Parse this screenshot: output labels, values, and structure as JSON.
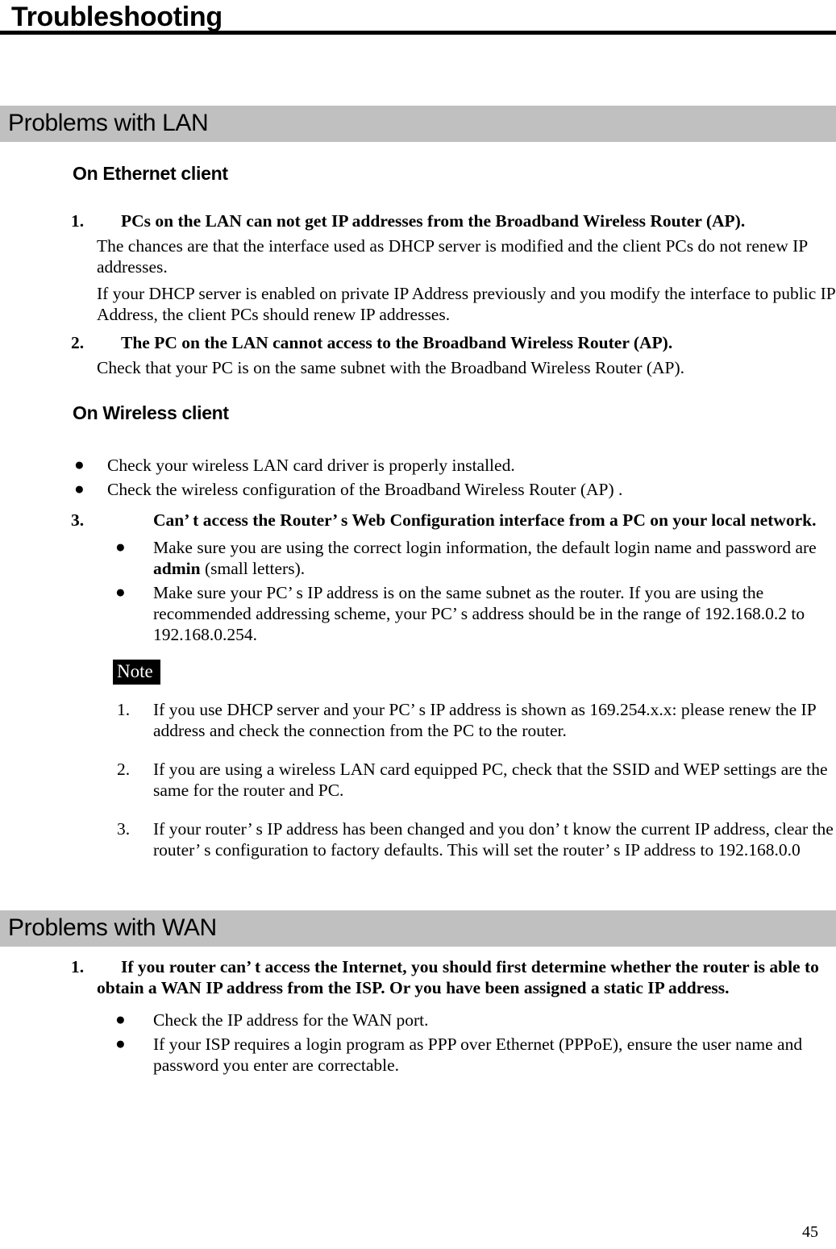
{
  "document": {
    "chapter_title": "Troubleshooting",
    "page_number": "45"
  },
  "sections": {
    "lan": {
      "bar_label": "Problems with LAN",
      "ethernet": {
        "heading": "On Ethernet client",
        "item1": {
          "marker": "1.",
          "title": "PCs on the LAN can not get IP addresses from the Broadband Wireless Router (AP).",
          "para1": "The chances are that the interface used as DHCP server is modified and the client PCs do not renew IP addresses.",
          "para2": "If your DHCP server is enabled on private IP Address previously and you modify the interface to public IP Address, the client PCs should renew IP addresses."
        },
        "item2": {
          "marker": "2.",
          "title": "The PC on the LAN cannot access to the Broadband Wireless Router (AP).",
          "para1": "Check that your PC is on the same subnet with the Broadband Wireless Router (AP)."
        }
      },
      "wireless": {
        "heading": "On Wireless client",
        "bullets": [
          "Check your wireless LAN card driver is properly installed.",
          "Check the wireless configuration of the Broadband Wireless Router (AP) ."
        ],
        "item3": {
          "marker": "3.",
          "title": "Can’ t access the Router’ s Web Configuration interface from a PC on your local network.",
          "bullet1_before": "Make sure you are using the correct login information, the default login name and password are ",
          "bullet1_bold": "admin",
          "bullet1_after": " (small letters).",
          "bullet2": "Make sure your PC’ s IP address is on the same subnet as the router. If you are using the recommended addressing scheme, your PC’ s address should be in the range of 192.168.0.2 to 192.168.0.254."
        },
        "note": {
          "badge": "Note",
          "items": [
            {
              "marker": "1.",
              "text": "If you use DHCP server and your PC’ s IP address is shown as 169.254.x.x: please renew the IP address and check the connection from the PC to the router."
            },
            {
              "marker": "2.",
              "text": "If you are using a wireless LAN card equipped PC, check that the SSID and WEP settings are the same for the router and PC."
            },
            {
              "marker": "3.",
              "text": "If your router’ s IP address has been changed and you don’ t know the current IP address, clear the router’ s configuration to factory defaults. This will set the router’ s IP address to 192.168.0.0"
            }
          ]
        }
      }
    },
    "wan": {
      "bar_label": "Problems with WAN",
      "item1": {
        "marker": "1.",
        "title": "If you router can’ t access the Internet, you should first determine whether the router is able to obtain a WAN IP address from the ISP. Or you have been assigned a static IP address."
      },
      "bullets": [
        "Check the IP address for the WAN port.",
        "If your ISP requires a login program as PPP over Ethernet (PPPoE), ensure the user name and password you enter are correctable."
      ]
    }
  },
  "colors": {
    "section_bar_bg": "#c0c0c0",
    "note_badge_bg": "#000000",
    "note_badge_fg": "#ffffff",
    "text": "#000000",
    "page_bg": "#ffffff"
  }
}
